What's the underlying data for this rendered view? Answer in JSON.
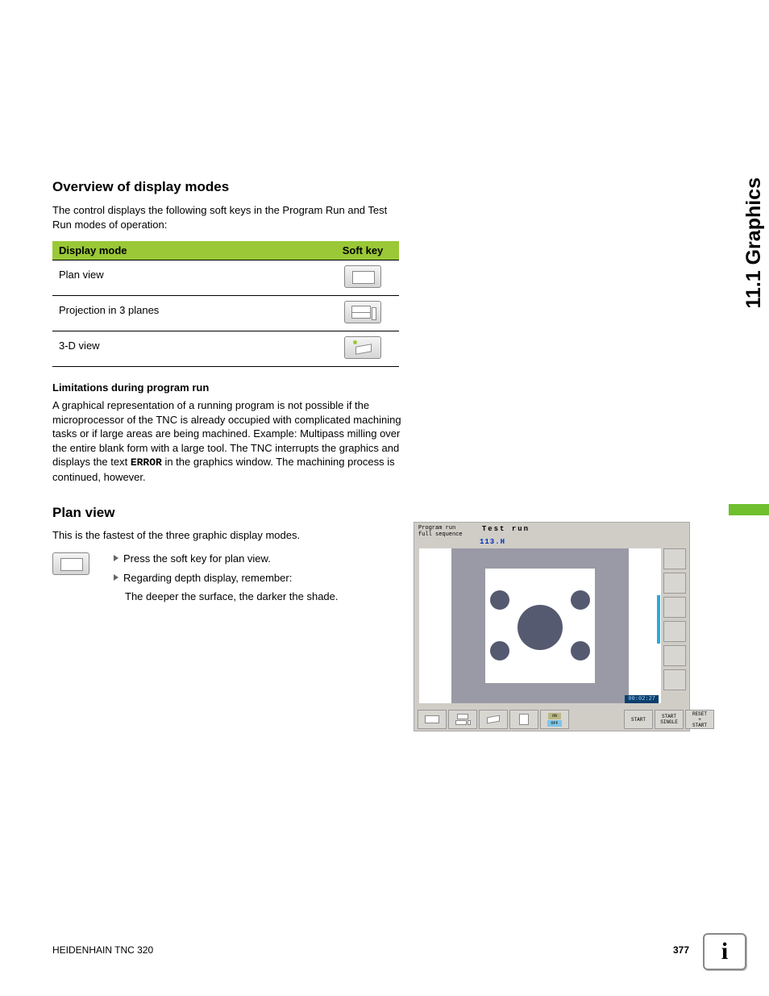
{
  "side_tab": "11.1 Graphics",
  "section1": {
    "heading": "Overview of display modes",
    "intro": "The control displays the following soft keys in the Program Run and Test Run modes of operation:",
    "table": {
      "col1": "Display mode",
      "col2": "Soft key",
      "rows": [
        {
          "label": "Plan view",
          "icon": "plan-view-icon"
        },
        {
          "label": "Projection in 3 planes",
          "icon": "three-planes-icon"
        },
        {
          "label": "3-D view",
          "icon": "three-d-icon"
        }
      ]
    },
    "limitations_heading": "Limitations during program run",
    "limitations_text_pre": "A graphical representation of a running program is not possible if the microprocessor of the TNC is already occupied with complicated machining tasks or if large areas are being machined. Example: Multipass milling over the entire blank form with a large tool. The TNC interrupts the graphics and displays the text ",
    "limitations_code": "ERROR",
    "limitations_text_post": " in the graphics window. The machining process is continued, however."
  },
  "section2": {
    "heading": "Plan view",
    "intro": "This is the fastest of the three graphic display modes.",
    "bullets": [
      "Press the soft key for plan view.",
      "Regarding depth display, remember:"
    ],
    "indent": "The deeper the surface, the darker the shade."
  },
  "screenshot": {
    "mode_line1": "Program run",
    "mode_line2": "full sequence",
    "title": "Test run",
    "file": "113.H",
    "timer": "00:02:27",
    "softkeys": {
      "on_off": {
        "on": "ON",
        "off": "OFF"
      },
      "start": "START",
      "start_single": {
        "l1": "START",
        "l2": "SINGLE"
      },
      "reset_start": {
        "l1": "RESET",
        "l2": "+",
        "l3": "START"
      }
    }
  },
  "footer": {
    "left": "HEIDENHAIN TNC 320",
    "page": "377"
  },
  "info_glyph": "i"
}
